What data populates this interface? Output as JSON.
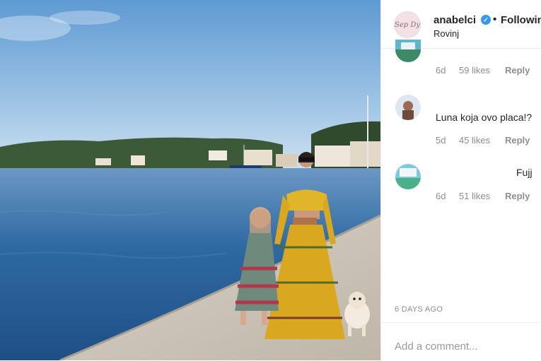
{
  "post": {
    "username": "anabelci",
    "follow_label": "Following",
    "location": "Rovinj",
    "avatar_text": "Sep Dy"
  },
  "comments": [
    {
      "text": "",
      "age": "6d",
      "likes": "59 likes",
      "reply": "Reply"
    },
    {
      "text": "Luna koja ovo placa!?",
      "age": "5d",
      "likes": "45 likes",
      "reply": "Reply"
    },
    {
      "text": "Fujj",
      "age": "6d",
      "likes": "51 likes",
      "reply": "Reply"
    }
  ],
  "footer": {
    "time_ago": "6 DAYS AGO",
    "add_comment_placeholder": "Add a comment..."
  },
  "colors": {
    "verified": "#3897f0",
    "sea": "#2a5f96",
    "sky": "#7fb3de"
  },
  "icons": [
    "verified-badge-icon"
  ]
}
